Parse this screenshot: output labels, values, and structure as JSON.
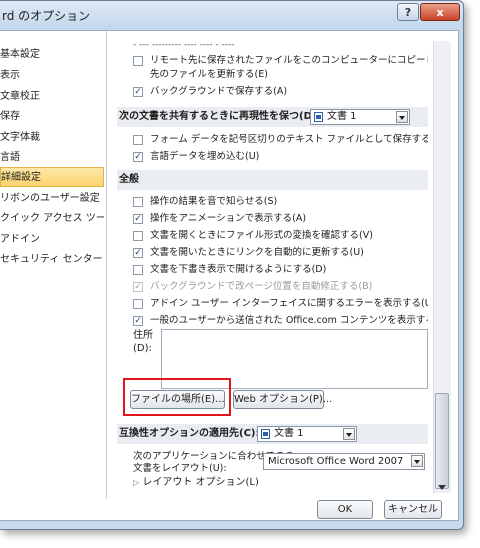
{
  "window": {
    "title": "rd のオプション",
    "help_label": "?",
    "close_label": "x"
  },
  "sidebar": {
    "items": [
      {
        "label": "基本設定"
      },
      {
        "label": "表示"
      },
      {
        "label": "文章校正"
      },
      {
        "label": "保存"
      },
      {
        "label": "文字体裁"
      },
      {
        "label": "言語"
      },
      {
        "label": "詳細設定",
        "active": true
      },
      {
        "label": "リボンのユーザー設定"
      },
      {
        "label": "クイック アクセス ツール バー"
      },
      {
        "label": "アドイン"
      },
      {
        "label": "セキュリティ センター"
      }
    ]
  },
  "top_options": [
    {
      "label": "リモート先に保存されたファイルをこのコンピューターにコピーして、保存時にリモート",
      "label2": "先のファイルを更新する(E)",
      "checked": false
    },
    {
      "label": "バックグラウンドで保存する(A)",
      "checked": true
    }
  ],
  "share_section": {
    "header": "次の文書を共有するときに再現性を保つ(D):",
    "select_value": "文書 1",
    "options": [
      {
        "label": "フォーム データを記号区切りのテキスト ファイルとして保存する(F)",
        "checked": false
      },
      {
        "label": "言語データを埋め込む(U)",
        "checked": true
      }
    ]
  },
  "general_section": {
    "header": "全般",
    "options": [
      {
        "label": "操作の結果を音で知らせる(S)",
        "checked": false,
        "disabled": false
      },
      {
        "label": "操作をアニメーションで表示する(A)",
        "checked": true,
        "disabled": false
      },
      {
        "label": "文書を開くときにファイル形式の変換を確認する(V)",
        "checked": false,
        "disabled": false
      },
      {
        "label": "文書を開いたときにリンクを自動的に更新する(U)",
        "checked": true,
        "disabled": false
      },
      {
        "label": "文書を下書き表示で開けるようにする(D)",
        "checked": false,
        "disabled": false
      },
      {
        "label": "バックグラウンドで改ページ位置を自動修正する(B)",
        "checked": true,
        "disabled": true
      },
      {
        "label": "アドイン ユーザー インターフェイスに関するエラーを表示する(U)",
        "checked": false,
        "disabled": false
      },
      {
        "label": "一般のユーザーから送信された Office.com コンテンツを表示する(B)",
        "checked": true,
        "disabled": false
      }
    ],
    "address_label": "住所",
    "address_label2": "(D):",
    "file_location_button": "ファイルの場所(E)...",
    "web_options_button": "Web オプション(P)..."
  },
  "compat_section": {
    "header": "互換性オプションの適用先(C):",
    "select_value": "文書 1",
    "layout_label": "次のアプリケーションに合わせてこの",
    "layout_label2": "文書をレイアウト(U):",
    "layout_value": "Microsoft Office Word 2007",
    "layout_options_label": "レイアウト オプション(L)"
  },
  "footer": {
    "ok_label": "OK",
    "cancel_label": "キャンセル"
  },
  "colors": {
    "highlight": "#e0161c",
    "active_item": "#fcd36f"
  }
}
